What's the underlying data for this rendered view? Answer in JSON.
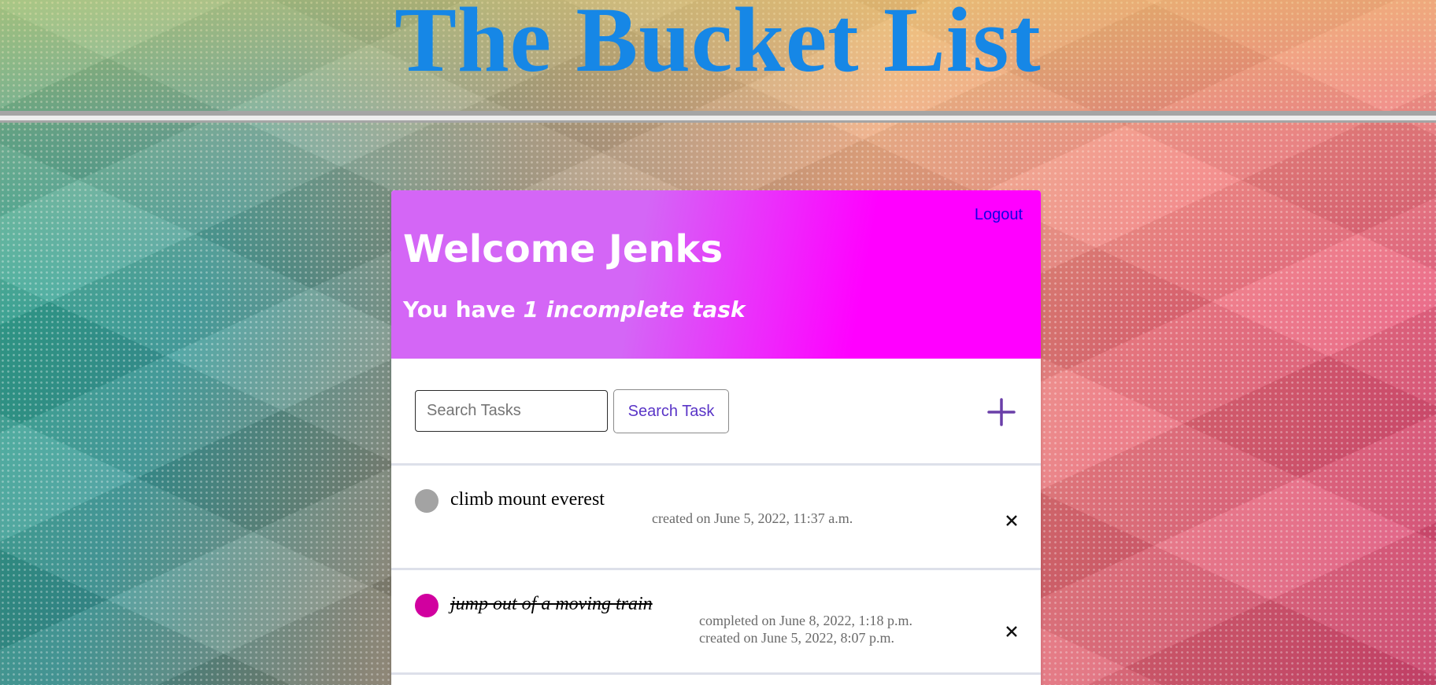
{
  "site": {
    "title": "The Bucket List",
    "title_color": "#1687e6"
  },
  "card": {
    "logout_label": "Logout",
    "welcome": "Welcome Jenks",
    "summary_prefix": "You have ",
    "summary_emphasis": "1 incomplete task",
    "header_gradient_start": "#d466f6",
    "header_gradient_end": "#ff00ff"
  },
  "search": {
    "placeholder": "Search Tasks",
    "value": "",
    "button_label": "Search Task"
  },
  "add": {
    "icon": "plus-icon",
    "color": "#6a3fa8"
  },
  "tasks": [
    {
      "title": "climb mount everest",
      "completed": false,
      "status_color": "#a3a3a3",
      "completed_on": "",
      "created_on": "created on June 5, 2022, 11:37 a.m.",
      "delete_icon": "close-icon"
    },
    {
      "title": "jump out of a moving train",
      "completed": true,
      "status_color": "#d1009f",
      "completed_on": "completed on June 8, 2022, 1:18 p.m.",
      "created_on": "created on June 5, 2022, 8:07 p.m.",
      "delete_icon": "close-icon"
    }
  ]
}
